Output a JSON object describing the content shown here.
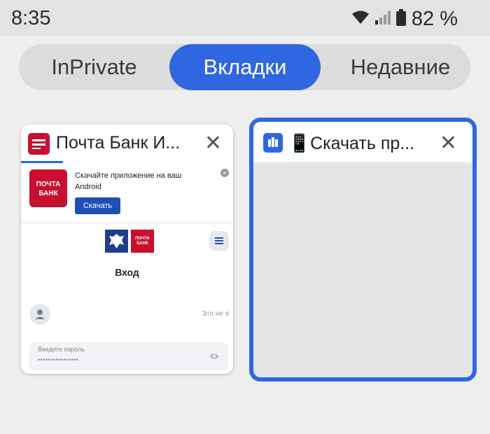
{
  "status_bar": {
    "time": "8:35",
    "battery": "82 %",
    "icons": [
      "wifi-icon",
      "signal-icon",
      "battery-icon"
    ]
  },
  "segments": {
    "inprivate": "InPrivate",
    "tabs": "Вкладки",
    "recent": "Недавние",
    "selected": "tabs"
  },
  "cards": [
    {
      "title": "Почта Банк И...",
      "close": "✕",
      "page": {
        "banner_logo": "ПОЧТА БАНК",
        "banner_text": "Скачайте приложение на ваш Android",
        "banner_button": "Скачать",
        "small_logo": "ПОЧТА БАНК",
        "login_title": "Вход",
        "not_me": "Это не я",
        "password_label": "Введите пароль",
        "password_value": "••••••••••••••••"
      }
    },
    {
      "title": "📱Скачать пр...",
      "close": "✕"
    }
  ],
  "colors": {
    "accent": "#2e67e0",
    "bank_red": "#c8102e"
  }
}
